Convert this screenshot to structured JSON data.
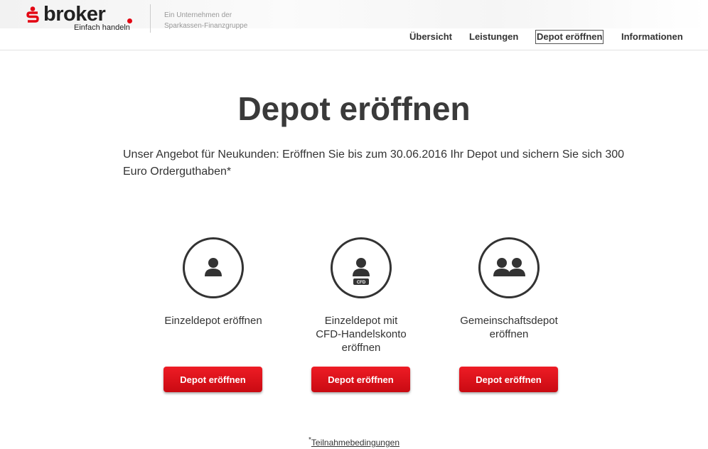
{
  "header": {
    "logo_word": "broker",
    "logo_tagline": "Einfach handeln",
    "group_line1": "Ein Unternehmen der",
    "group_line2": "Sparkassen-Finanzgruppe",
    "brand_color": "#e30613"
  },
  "nav": {
    "items": [
      {
        "label": "Übersicht"
      },
      {
        "label": "Leistungen"
      },
      {
        "label": "Depot eröffnen",
        "active": true
      },
      {
        "label": "Informationen"
      }
    ]
  },
  "main": {
    "title": "Depot eröffnen",
    "intro_line1": "Unser Angebot für Neukunden: Eröffnen Sie bis zum 30.06.2016 Ihr Depot und sichern Sie sich 300",
    "intro_line2": "Euro Orderguthaben*"
  },
  "options": [
    {
      "icon": "person-icon",
      "label_line1": "Einzeldepot eröffnen",
      "label_line2": "",
      "label_line3": "",
      "button_label": "Depot eröffnen"
    },
    {
      "icon": "person-cfd-icon",
      "badge": "CFD",
      "label_line1": "Einzeldepot mit",
      "label_line2": "CFD-Handelskonto",
      "label_line3": "eröffnen",
      "button_label": "Depot eröffnen"
    },
    {
      "icon": "two-persons-icon",
      "label_line1": "Gemeinschaftsdepot",
      "label_line2": "eröffnen",
      "label_line3": "",
      "button_label": "Depot eröffnen"
    }
  ],
  "footer": {
    "asterisk": "*",
    "conditions_link": "Teilnahmebedingungen"
  }
}
